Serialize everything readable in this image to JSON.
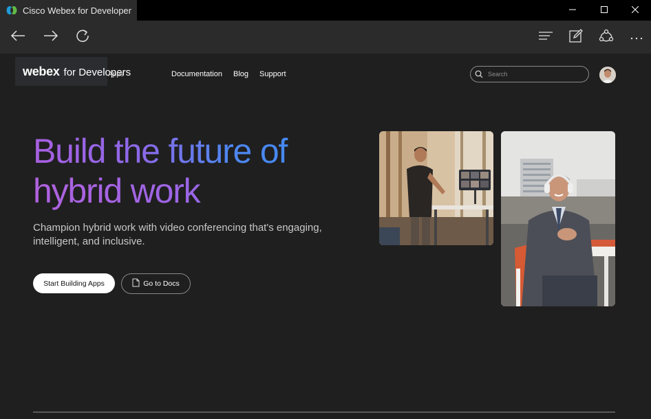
{
  "browser": {
    "tab_title": "Cisco Webex for Developer",
    "window_controls": [
      "minimize-icon",
      "maximize-icon",
      "close-icon"
    ],
    "toolbar_icons": [
      "back-arrow-icon",
      "forward-arrow-icon",
      "refresh-icon",
      "reading-list-icon",
      "web-note-icon",
      "share-icon",
      "more-icon"
    ]
  },
  "site": {
    "logo_brand": "webex",
    "logo_suffix": "for Developers",
    "logo_overlap_text": "Apps",
    "nav": {
      "documentation": "Documentation",
      "blog": "Blog",
      "support": "Support"
    },
    "search": {
      "placeholder": "Search",
      "value": ""
    }
  },
  "hero": {
    "title_line1": "Build the future of",
    "title_line2": "hybrid work",
    "subtitle": "Champion hybrid work with video conferencing that's engaging, intelligent, and inclusive.",
    "primary_button": "Start Building Apps",
    "secondary_button": "Go to Docs"
  },
  "colors": {
    "page_bg": "#1f1f1f",
    "chrome_bg": "#2b2b2b",
    "gradient_start": "#a85fe0",
    "gradient_end": "#3a8df2"
  }
}
